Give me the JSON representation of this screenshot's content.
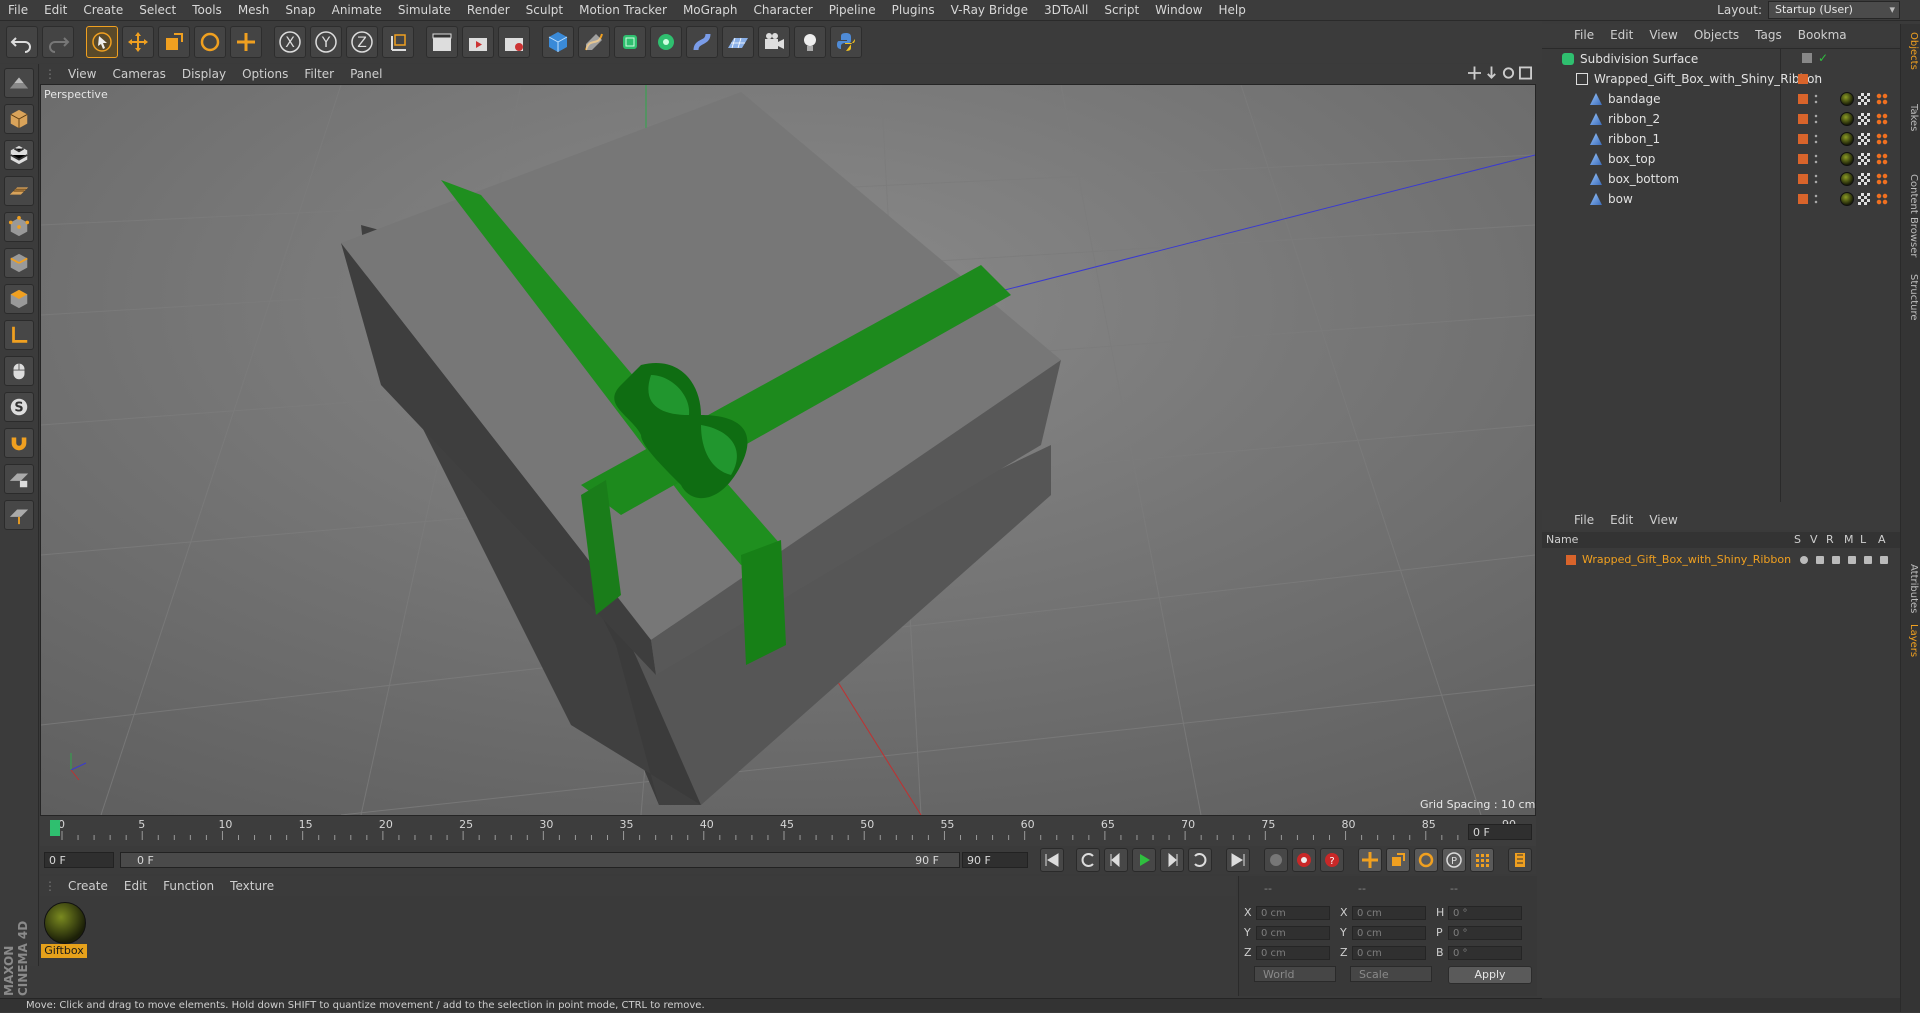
{
  "menubar": {
    "items": [
      "File",
      "Edit",
      "Create",
      "Select",
      "Tools",
      "Mesh",
      "Snap",
      "Animate",
      "Simulate",
      "Render",
      "Sculpt",
      "Motion Tracker",
      "MoGraph",
      "Character",
      "Pipeline",
      "Plugins",
      "V-Ray Bridge",
      "3DToAll",
      "Script",
      "Window",
      "Help"
    ],
    "layout_label": "Layout:",
    "layout_value": "Startup (User)"
  },
  "viewport": {
    "menu": [
      "View",
      "Cameras",
      "Display",
      "Options",
      "Filter",
      "Panel"
    ],
    "camera_label": "Perspective",
    "grid_spacing": "Grid Spacing : 10 cm"
  },
  "timeline": {
    "ticks": [
      "0",
      "5",
      "10",
      "15",
      "20",
      "25",
      "30",
      "35",
      "40",
      "45",
      "50",
      "55",
      "60",
      "65",
      "70",
      "75",
      "80",
      "85",
      "90"
    ],
    "current_frame": "0 F",
    "start_field": "0 F",
    "range_start": "0 F",
    "range_end": "90 F",
    "end_field": "90 F",
    "right_field": "0 F"
  },
  "material_manager": {
    "menu": [
      "Create",
      "Edit",
      "Function",
      "Texture"
    ],
    "material_name": "Giftbox"
  },
  "coordinates": {
    "header": [
      "--",
      "--",
      "--"
    ],
    "rows": [
      {
        "l1": "X",
        "v1": "0 cm",
        "l2": "X",
        "v2": "0 cm",
        "l3": "H",
        "v3": "0 °"
      },
      {
        "l1": "Y",
        "v1": "0 cm",
        "l2": "Y",
        "v2": "0 cm",
        "l3": "P",
        "v3": "0 °"
      },
      {
        "l1": "Z",
        "v1": "0 cm",
        "l2": "Z",
        "v2": "0 cm",
        "l3": "B",
        "v3": "0 °"
      }
    ],
    "space": "World",
    "mode": "Scale",
    "apply": "Apply"
  },
  "status": "Move: Click and drag to move elements. Hold down SHIFT to quantize movement / add to the selection in point mode, CTRL to remove.",
  "object_manager": {
    "menu": [
      "File",
      "Edit",
      "View",
      "Objects",
      "Tags",
      "Bookma"
    ],
    "objects": [
      {
        "name": "Subdivision Surface",
        "level": 0
      },
      {
        "name": "Wrapped_Gift_Box_with_Shiny_Ribbon",
        "level": 1
      },
      {
        "name": "bandage",
        "level": 2
      },
      {
        "name": "ribbon_2",
        "level": 2
      },
      {
        "name": "ribbon_1",
        "level": 2
      },
      {
        "name": "box_top",
        "level": 2
      },
      {
        "name": "box_bottom",
        "level": 2
      },
      {
        "name": "bow",
        "level": 2
      }
    ]
  },
  "layer_manager": {
    "menu": [
      "File",
      "Edit",
      "View"
    ],
    "columns": [
      "Name",
      "S",
      "V",
      "R",
      "M",
      "L",
      "A"
    ],
    "layers": [
      {
        "name": "Wrapped_Gift_Box_with_Shiny_Ribbon"
      }
    ]
  },
  "side_tabs": [
    "Objects",
    "Takes",
    "Content Browser",
    "Structure",
    "Attributes",
    "Layers"
  ],
  "branding": "MAXON CINEMA 4D",
  "colors": {
    "accent": "#f0a020",
    "ribbon_green": "#1e8a1e",
    "box_grey": "#6a6a6a",
    "layer_orange": "#d9642b"
  }
}
